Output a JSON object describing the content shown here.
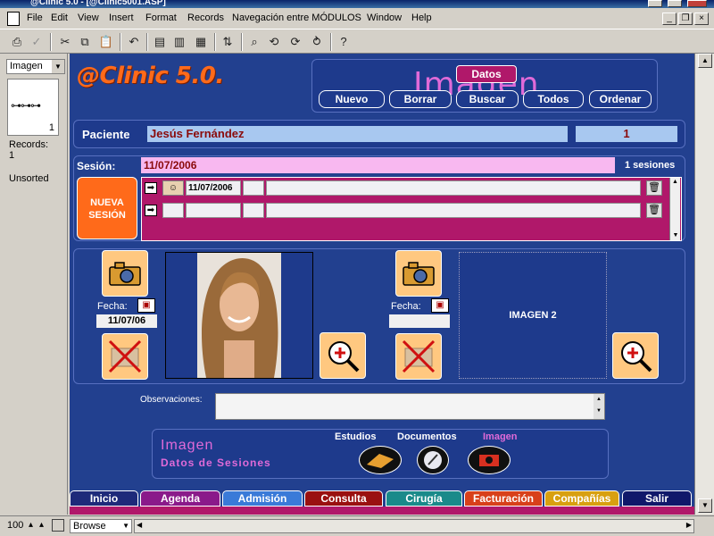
{
  "window": {
    "title": "@Clinic 5.0 - [@Clinic5001.ASP]"
  },
  "menu": [
    "File",
    "Edit",
    "View",
    "Insert",
    "Format",
    "Records",
    "Navegación entre MÓDULOS",
    "Window",
    "Help"
  ],
  "left_panel": {
    "layout": "Imagen",
    "record_num": "1",
    "records_label": "Records:",
    "records_count": "1",
    "sort_status": "Unsorted"
  },
  "header": {
    "logo": "@Clinic 5.0.",
    "module_title": "Imagen",
    "datos_label": "Datos",
    "buttons": [
      "Nuevo",
      "Borrar",
      "Buscar",
      "Todos",
      "Ordenar"
    ]
  },
  "patient": {
    "label": "Paciente",
    "name": "Jesús Fernández",
    "id": "1"
  },
  "session": {
    "label": "Sesión:",
    "date": "11/07/2006",
    "count_text": "1 sesiones",
    "new_button": "NUEVA SESIÓN",
    "rows": [
      {
        "date": "11/07/2006"
      },
      {
        "date": ""
      }
    ]
  },
  "images": {
    "fecha_label": "Fecha:",
    "image1_date": "11/07/06",
    "image2_date": "",
    "image2_placeholder": "IMAGEN 2"
  },
  "observaciones": {
    "label": "Observaciones:",
    "value": ""
  },
  "footer_panel": {
    "title": "Imagen",
    "subtitle": "Datos de Sesiones",
    "links": [
      "Estudios",
      "Documentos",
      "Imagen"
    ]
  },
  "tabs": [
    {
      "label": "Inicio",
      "color": "#1e2a7a"
    },
    {
      "label": "Agenda",
      "color": "#8a1a8a"
    },
    {
      "label": "Admisión",
      "color": "#3a7ad8"
    },
    {
      "label": "Consulta",
      "color": "#9a1010"
    },
    {
      "label": "Cirugía",
      "color": "#1a8a8a"
    },
    {
      "label": "Facturación",
      "color": "#d8401a"
    },
    {
      "label": "Compañías",
      "color": "#d8a010"
    },
    {
      "label": "Salir",
      "color": "#10186a"
    }
  ],
  "status": {
    "zoom": "100",
    "mode": "Browse"
  },
  "colors": {
    "main_bg": "#22408f",
    "accent": "#ff6a1a",
    "title_pink": "#e06ad8",
    "patient_field": "#a8c8f0",
    "session_field": "#f8b8f0",
    "session_strip": "#b0186a"
  }
}
